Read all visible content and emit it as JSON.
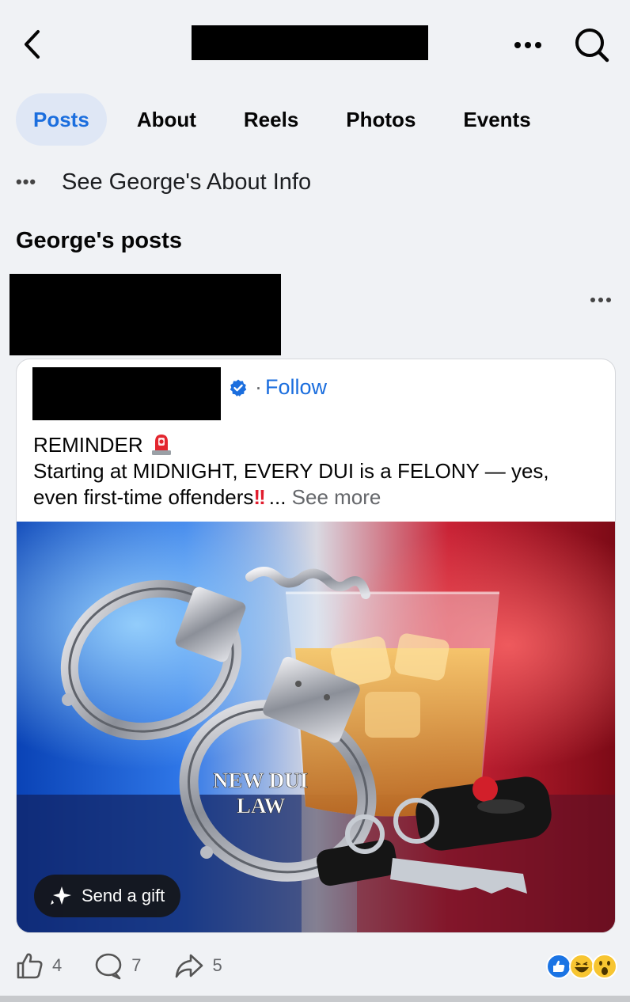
{
  "header": {
    "back_icon": "chevron-left-icon",
    "more_icon": "more-horizontal-icon",
    "search_icon": "search-icon"
  },
  "tabs": [
    {
      "label": "Posts",
      "active": true
    },
    {
      "label": "About",
      "active": false
    },
    {
      "label": "Reels",
      "active": false
    },
    {
      "label": "Photos",
      "active": false
    },
    {
      "label": "Events",
      "active": false
    }
  ],
  "about_link": {
    "dots": "•••",
    "label": "See George's About Info"
  },
  "section_title": "George's posts",
  "post": {
    "menu_icon": "more-horizontal-icon",
    "shared": {
      "verified_icon": "verified-badge-icon",
      "follow_separator": "·",
      "follow_label": "Follow",
      "text_line1": "REMINDER",
      "text_line2": "Starting at MIDNIGHT, EVERY DUI is a FELONY — yes,",
      "text_line3": "even first-time offenders",
      "ellipsis": "...",
      "see_more": "See more",
      "image_caption_line1": "NEW DUI",
      "image_caption_line2": "LAW",
      "gift_label": "Send a gift"
    },
    "actions": {
      "like_count": "4",
      "comment_count": "7",
      "share_count": "5"
    },
    "reaction_icons": [
      "like-reaction-icon",
      "haha-reaction-icon",
      "wow-reaction-icon"
    ]
  },
  "colors": {
    "accent": "#1b6ede",
    "active_tab_bg": "#dfe7f5",
    "background": "#f0f2f5",
    "muted_text": "#65676b"
  }
}
